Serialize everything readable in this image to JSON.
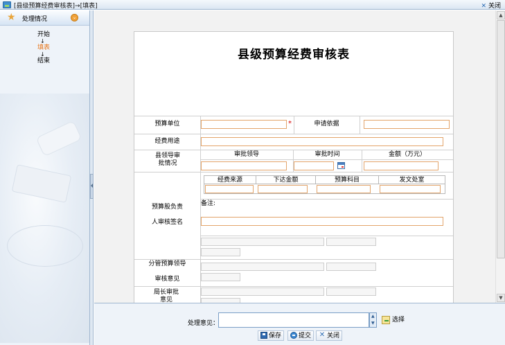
{
  "window": {
    "title": "[县级预算经费审核表]→[填表]",
    "close_label": "关闭"
  },
  "sidebar": {
    "header_label": "处理情况",
    "steps": [
      {
        "label": "开始",
        "current": false
      },
      {
        "label": "填表",
        "current": true
      },
      {
        "label": "结束",
        "current": false
      }
    ],
    "arrow": "↓"
  },
  "form": {
    "title": "县级预算经费审核表",
    "budget_unit_label": "预算单位",
    "required_mark": "*",
    "application_basis_label": "申请依据",
    "purpose_label": "经费用途",
    "county_leader_label": "县领导审批情况",
    "approval_leader_header": "审批领导",
    "approval_time_header": "审批时间",
    "amount_header": "金额（万元）",
    "budget_section_head_label_1": "预算股负责",
    "budget_section_head_label_2": "人审核签名",
    "subtable_headers": [
      "经费来源",
      "下达金额",
      "预算科目",
      "发文处室"
    ],
    "remark_label": "备注:",
    "deputy_leader_label_1": "分管预算领导",
    "deputy_leader_label_2": "审核意见",
    "director_label": "局长审批意见"
  },
  "bottom": {
    "opinion_label": "处理意见：",
    "select_label": "选择",
    "save_label": "保存",
    "submit_label": "提交",
    "close_label": "关闭"
  }
}
